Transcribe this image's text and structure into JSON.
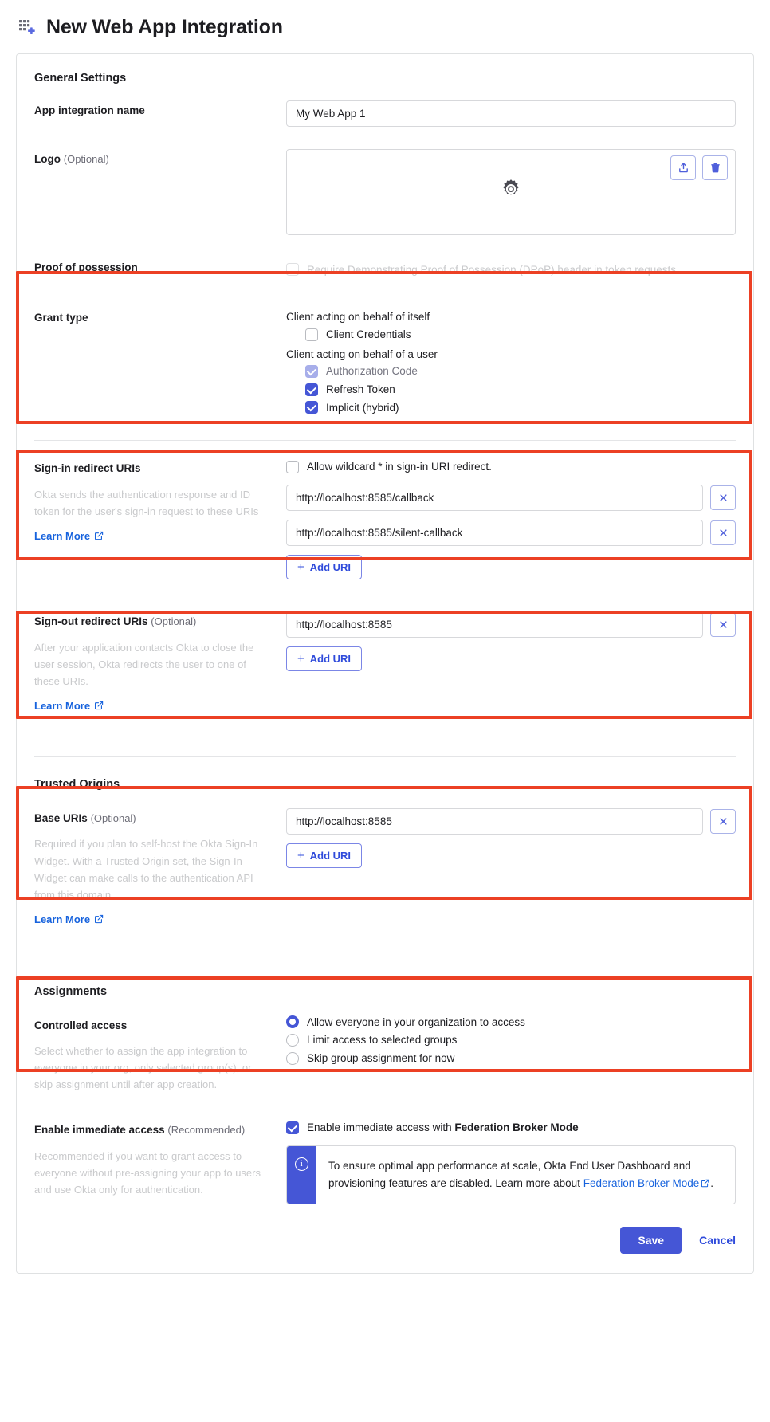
{
  "header": {
    "title": "New Web App Integration",
    "icon": "app-grid-plus-icon"
  },
  "general": {
    "section_title": "General Settings",
    "app_name": {
      "label": "App integration name",
      "value": "My Web App 1"
    },
    "logo": {
      "label": "Logo",
      "optional": "(Optional)",
      "upload_icon": "upload-icon",
      "delete_icon": "trash-icon",
      "placeholder_icon": "gear-icon"
    },
    "proof_of_possession": {
      "label": "Proof of possession",
      "checkbox_label": "Require Demonstrating Proof of Possession (DPoP) header in token requests",
      "checked": false
    },
    "grant_type": {
      "label": "Grant type",
      "group_self": "Client acting on behalf of itself",
      "group_user": "Client acting on behalf of a user",
      "options_self": [
        {
          "label": "Client Credentials",
          "checked": false,
          "disabled": false
        }
      ],
      "options_user": [
        {
          "label": "Authorization Code",
          "checked": true,
          "disabled": true
        },
        {
          "label": "Refresh Token",
          "checked": true,
          "disabled": false
        },
        {
          "label": "Implicit (hybrid)",
          "checked": true,
          "disabled": false
        }
      ]
    },
    "signin_redirect": {
      "label": "Sign-in redirect URIs",
      "help": "Okta sends the authentication response and ID token for the user's sign-in request to these URIs",
      "learn_more": "Learn More",
      "wildcard_label": "Allow wildcard * in sign-in URI redirect.",
      "wildcard_checked": false,
      "uris": [
        "http://localhost:8585/callback",
        "http://localhost:8585/silent-callback"
      ],
      "add_label": "Add URI",
      "remove_icon": "close-icon"
    },
    "signout_redirect": {
      "label": "Sign-out redirect URIs",
      "optional": "(Optional)",
      "help": "After your application contacts Okta to close the user session, Okta redirects the user to one of these URIs.",
      "learn_more": "Learn More",
      "uris": [
        "http://localhost:8585"
      ],
      "add_label": "Add URI",
      "remove_icon": "close-icon"
    }
  },
  "trusted_origins": {
    "section_title": "Trusted Origins",
    "base_uris": {
      "label": "Base URIs",
      "optional": "(Optional)",
      "help": "Required if you plan to self-host the Okta Sign-In Widget. With a Trusted Origin set, the Sign-In Widget can make calls to the authentication API from this domain.",
      "learn_more": "Learn More",
      "uris": [
        "http://localhost:8585"
      ],
      "add_label": "Add URI",
      "remove_icon": "close-icon"
    }
  },
  "assignments": {
    "section_title": "Assignments",
    "controlled_access": {
      "label": "Controlled access",
      "help": "Select whether to assign the app integration to everyone in your org, only selected group(s), or skip assignment until after app creation.",
      "options": [
        {
          "label": "Allow everyone in your organization to access",
          "selected": true
        },
        {
          "label": "Limit access to selected groups",
          "selected": false
        },
        {
          "label": "Skip group assignment for now",
          "selected": false
        }
      ]
    },
    "immediate_access": {
      "label": "Enable immediate access",
      "recommended": "(Recommended)",
      "help": "Recommended if you want to grant access to everyone without pre-assigning your app to users and use Okta only for authentication.",
      "checkbox_prefix": "Enable immediate access with ",
      "checkbox_strong": "Federation Broker Mode",
      "checked": true,
      "callout": {
        "icon": "info-icon",
        "text_before": "To ensure optimal app performance at scale, Okta End User Dashboard and provisioning features are disabled. Learn more about ",
        "link_text": "Federation Broker Mode",
        "link_icon": "external-link-icon",
        "text_after": "."
      }
    }
  },
  "footer": {
    "save": "Save",
    "cancel": "Cancel"
  },
  "colors": {
    "accent": "#4556d6",
    "link": "#1662dd",
    "highlight": "#ec4024"
  }
}
